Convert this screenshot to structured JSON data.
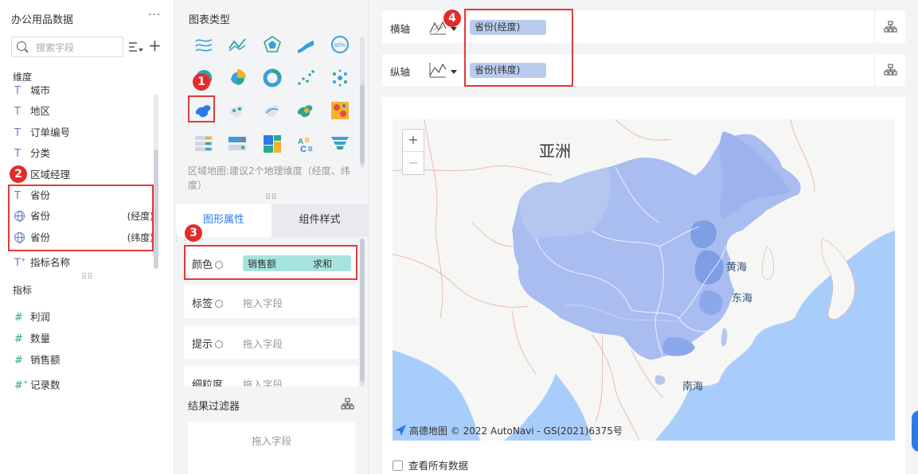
{
  "left_panel": {
    "dataset_title": "办公用品数据",
    "more": "···",
    "search_placeholder": "搜索字段",
    "dimensions_title": "维度",
    "dimensions": [
      {
        "icon": "T",
        "label": "城市",
        "suffix": ""
      },
      {
        "icon": "T",
        "label": "地区",
        "suffix": ""
      },
      {
        "icon": "T",
        "label": "订单编号",
        "suffix": ""
      },
      {
        "icon": "T",
        "label": "分类",
        "suffix": ""
      },
      {
        "icon": "T",
        "label": "区域经理",
        "suffix": ""
      },
      {
        "icon": "T",
        "label": "省份",
        "suffix": ""
      },
      {
        "icon": "globe",
        "label": "省份",
        "suffix": "(经度)"
      },
      {
        "icon": "globe",
        "label": "省份",
        "suffix": "(纬度)"
      },
      {
        "icon": "T+",
        "label": "指标名称",
        "suffix": ""
      }
    ],
    "measures_title": "指标",
    "measures": [
      {
        "icon": "#",
        "label": "利润"
      },
      {
        "icon": "#",
        "label": "数量"
      },
      {
        "icon": "#",
        "label": "销售额"
      },
      {
        "icon": "#+",
        "label": "记录数"
      }
    ]
  },
  "middle_panel": {
    "chart_type_title": "图表类型",
    "chart_type_desc": "区域地图:建议2个地理维度（经度、纬度）",
    "tabs": [
      "图形属性",
      "组件样式"
    ],
    "properties": [
      {
        "label": "颜色",
        "value": "销售额",
        "agg": "求和"
      },
      {
        "label": "标签",
        "value": "拖入字段"
      },
      {
        "label": "提示",
        "value": "拖入字段"
      },
      {
        "label": "细粒度",
        "value": "拖入字段"
      }
    ],
    "filter_title": "结果过滤器",
    "filter_placeholder": "拖入字段",
    "grip": "⋮⋮"
  },
  "right_panel": {
    "x_axis_label": "横轴",
    "y_axis_label": "纵轴",
    "x_axis_field": "省份(经度)",
    "y_axis_field": "省份(纬度)",
    "map_labels": {
      "asia": "亚洲",
      "yellow_sea": "黄海",
      "east_sea": "东海",
      "south_sea": "南海"
    },
    "zoom_in": "+",
    "zoom_out": "−",
    "attribution": "高德地图 © 2022 AutoNavi - GS(2021)6375号",
    "see_all": "查看所有数据"
  },
  "badges": [
    "1",
    "2",
    "3",
    "4"
  ],
  "colors": {
    "accent": "#2c7be5",
    "highlight": "#e13a3a",
    "land": "#f5f5f5",
    "sea": "#a9cdfb",
    "china": "#aabdf0",
    "china_dark": "#7f9ee6",
    "pill_measure": "#a5e3dc",
    "pill_dim": "#b9ccef"
  }
}
